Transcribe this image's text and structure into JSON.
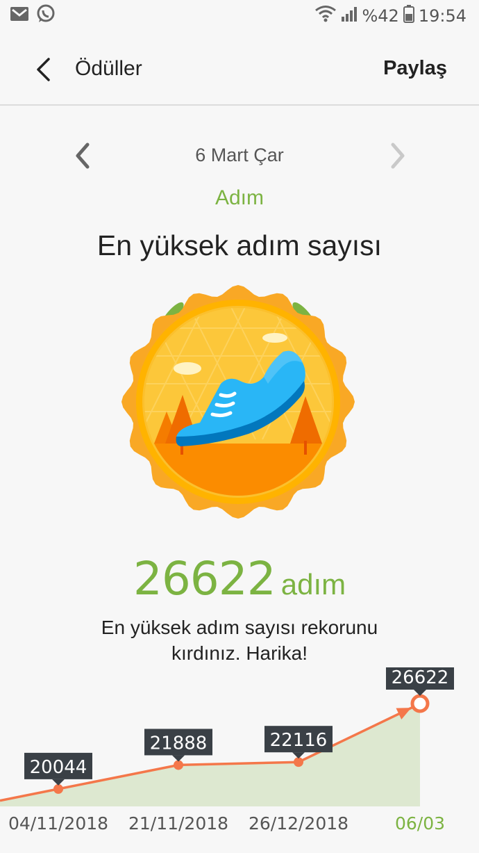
{
  "status_bar": {
    "left_icons": [
      "gmail-icon",
      "whatsapp-icon"
    ],
    "right_icons": [
      "wifi-icon",
      "signal-icon",
      "battery-icon"
    ],
    "battery": "%42",
    "time": "19:54"
  },
  "app_bar": {
    "title": "Ödüller",
    "share_label": "Paylaş"
  },
  "date_nav": {
    "date": "6 Mart Çar"
  },
  "award": {
    "category": "Adım",
    "title": "En yüksek adım sayısı",
    "value": "26622",
    "unit": "adım",
    "message": "En yüksek adım sayısı rekorunu kırdınız. Harika!"
  },
  "colors": {
    "accent_green": "#7cb342",
    "line_orange": "#f4774a",
    "area_fill": "#dde8d0",
    "tooltip_bg": "#3a4046"
  },
  "chart_data": {
    "type": "area",
    "x": [
      "04/11/2018",
      "21/11/2018",
      "26/12/2018",
      "06/03"
    ],
    "values": [
      20044,
      21888,
      22116,
      26622
    ],
    "point_labels": [
      "20044",
      "21888",
      "22116",
      "26622"
    ],
    "highlight": "06/03",
    "ylim": [
      18700,
      27800
    ]
  }
}
